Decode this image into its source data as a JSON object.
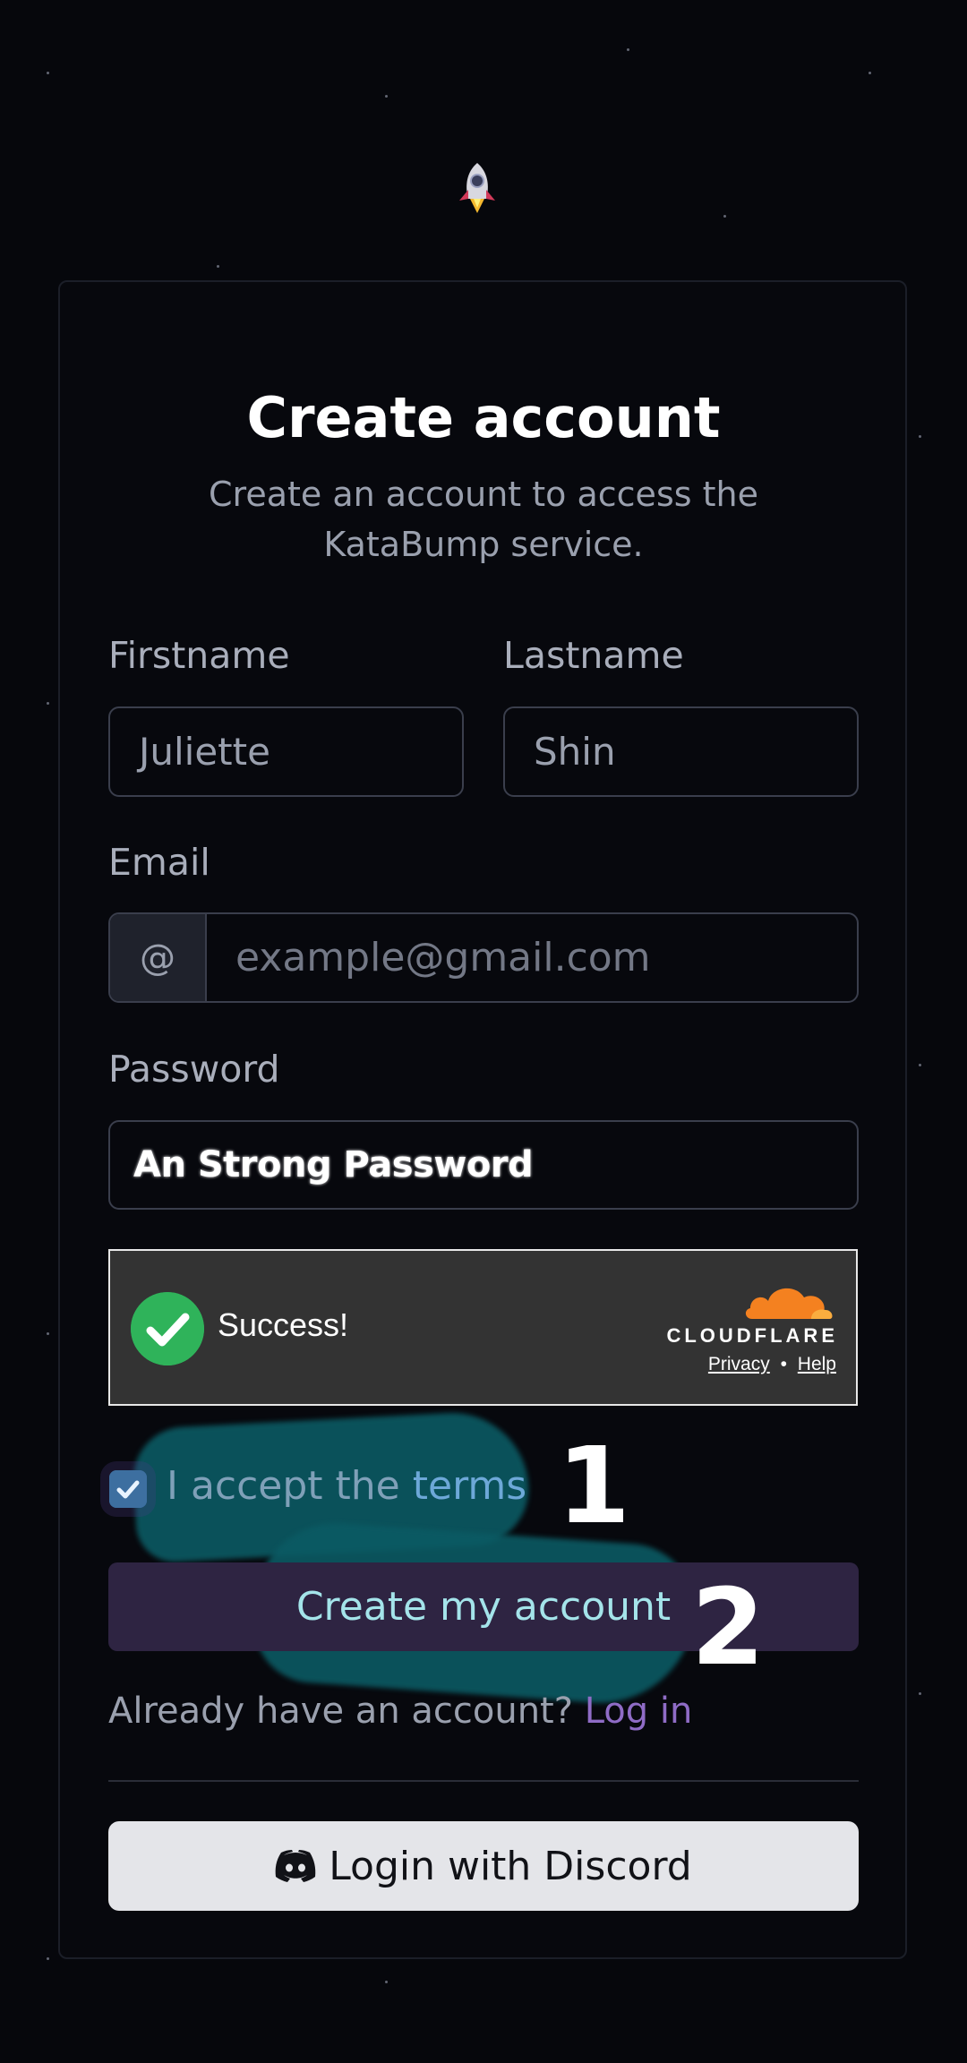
{
  "header": {
    "title": "Create account",
    "subtitle": "Create an account to access the KataBump service."
  },
  "form": {
    "firstname": {
      "label": "Firstname",
      "value": "Juliette"
    },
    "lastname": {
      "label": "Lastname",
      "value": "Shin"
    },
    "email": {
      "label": "Email",
      "prefix": "@",
      "placeholder": "example@gmail.com"
    },
    "password": {
      "label": "Password",
      "value": "An Strong Password"
    },
    "captcha": {
      "status": "Success!",
      "brand": "CLOUDFLARE",
      "privacy": "Privacy",
      "separator": "•",
      "help": "Help"
    },
    "terms": {
      "prefix": "I accept the ",
      "link": "terms",
      "checked": true
    },
    "submit_label": "Create my account"
  },
  "annotations": {
    "step1": "1",
    "step2": "2"
  },
  "footer": {
    "have_account": "Already have an account?",
    "login_link": "Log in",
    "discord_label": "Login with Discord"
  },
  "colors": {
    "accent": "#8f6cc6",
    "success": "#2fb35a",
    "cloudflare": "#f48120"
  }
}
